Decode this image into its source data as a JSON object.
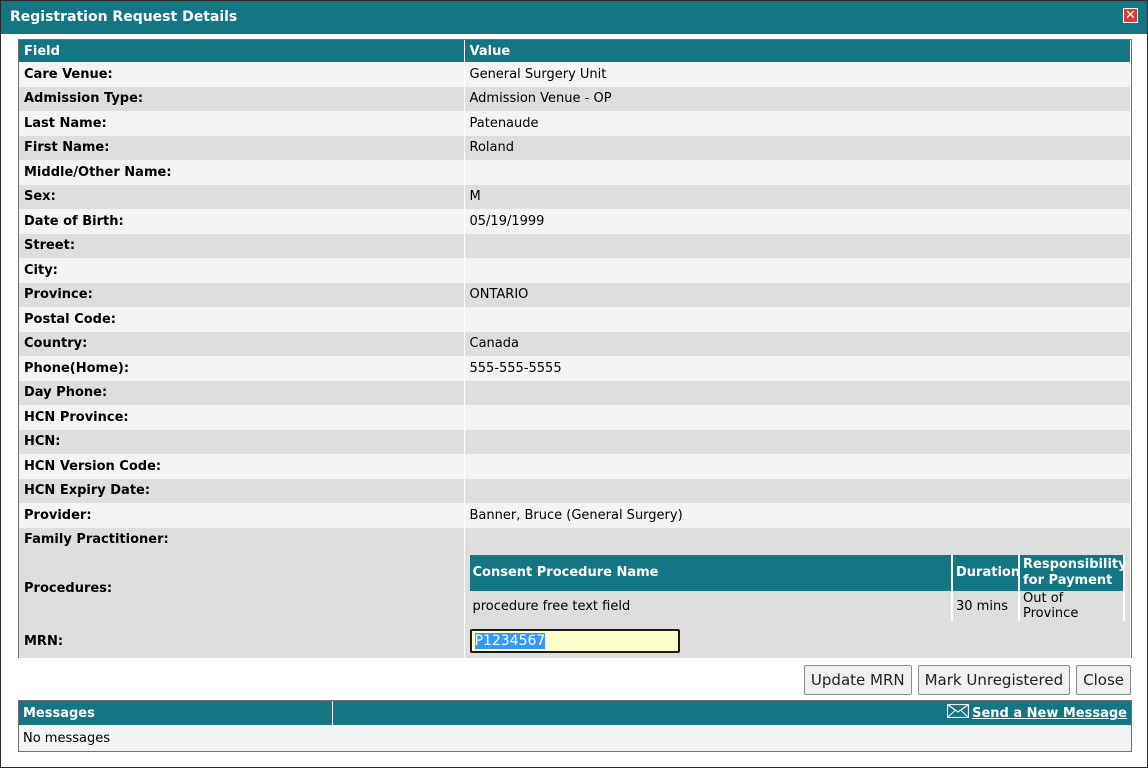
{
  "dialog": {
    "title": "Registration Request Details",
    "close_glyph": "✕"
  },
  "table": {
    "headers": [
      "Field",
      "Value"
    ],
    "rows": [
      {
        "label": "Care Venue:",
        "value": "General Surgery Unit"
      },
      {
        "label": "Admission Type:",
        "value": "Admission Venue - OP"
      },
      {
        "label": "Last Name:",
        "value": "Patenaude"
      },
      {
        "label": "First Name:",
        "value": "Roland"
      },
      {
        "label": "Middle/Other Name:",
        "value": ""
      },
      {
        "label": "Sex:",
        "value": "M"
      },
      {
        "label": "Date of Birth:",
        "value": "05/19/1999"
      },
      {
        "label": "Street:",
        "value": ""
      },
      {
        "label": "City:",
        "value": ""
      },
      {
        "label": "Province:",
        "value": "ONTARIO"
      },
      {
        "label": "Postal Code:",
        "value": ""
      },
      {
        "label": "Country:",
        "value": "Canada"
      },
      {
        "label": "Phone(Home):",
        "value": "555-555-5555"
      },
      {
        "label": "Day Phone:",
        "value": ""
      },
      {
        "label": "HCN Province:",
        "value": ""
      },
      {
        "label": "HCN:",
        "value": ""
      },
      {
        "label": "HCN Version Code:",
        "value": ""
      },
      {
        "label": "HCN Expiry Date:",
        "value": ""
      },
      {
        "label": "Provider:",
        "value": "Banner, Bruce (General Surgery)"
      },
      {
        "label": "Family Practitioner:",
        "value": ""
      }
    ],
    "procedures_label": "Procedures:",
    "procedures": {
      "headers": [
        "Consent Procedure Name",
        "Duration",
        "Responsibility for Payment"
      ],
      "rows": [
        [
          "procedure free text field",
          "30 mins",
          "Out of Province"
        ]
      ]
    },
    "mrn_label": "MRN:",
    "mrn_value": "P1234567"
  },
  "buttons": {
    "update_mrn": "Update MRN",
    "mark_unregistered": "Mark Unregistered",
    "close": "Close"
  },
  "messages": {
    "header": "Messages",
    "send_link": "Send a New Message",
    "empty_text": "No messages"
  },
  "colors": {
    "header_teal": "#147683",
    "row_light": "#f3f3f3",
    "row_dark": "#dedede",
    "input_bg": "#ffffcc"
  }
}
